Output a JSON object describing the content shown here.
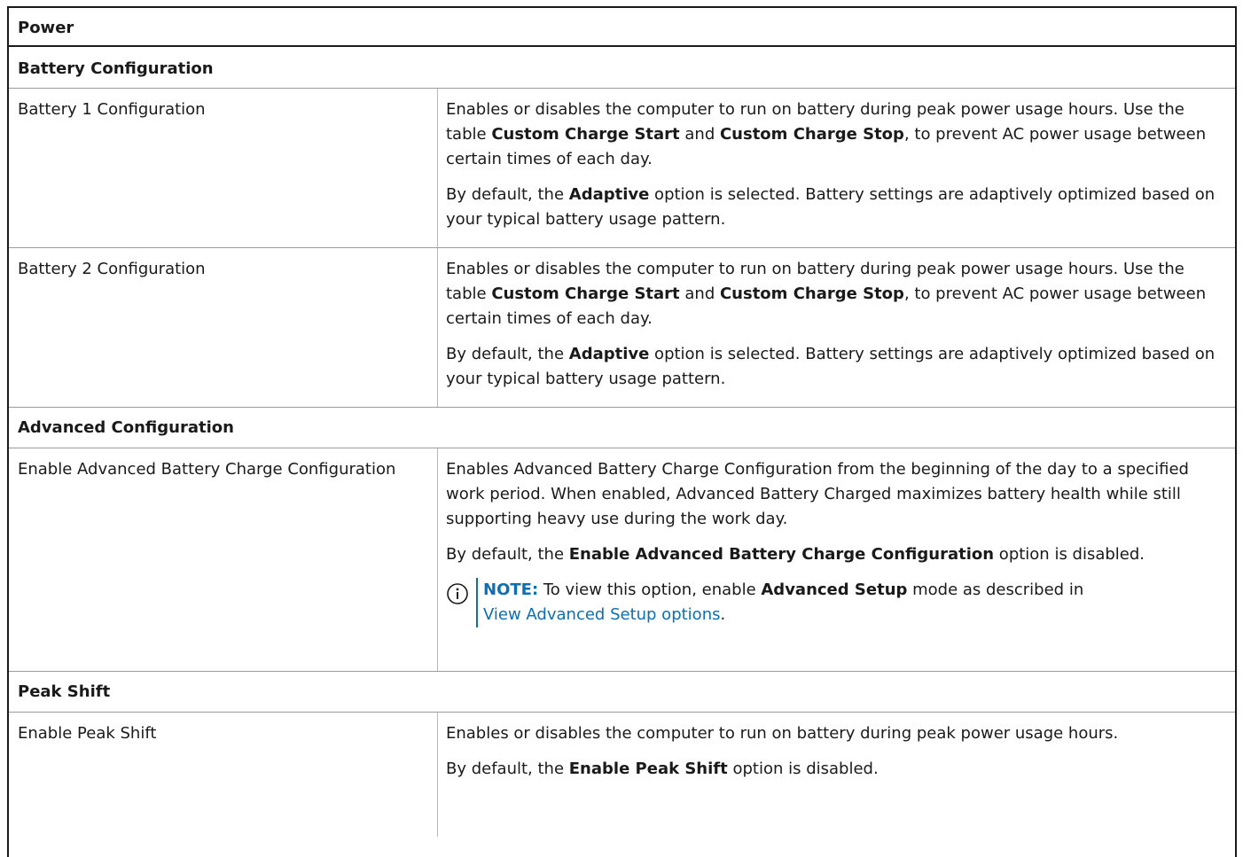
{
  "title": "Power",
  "sections": {
    "battery": {
      "heading": "Battery Configuration",
      "rows": [
        {
          "name": "Battery 1 Configuration",
          "desc1_a": "Enables or disables the computer to run on battery during peak power usage hours. Use the table ",
          "desc1_b1": "Custom Charge Start",
          "desc1_c": " and ",
          "desc1_b2": "Custom Charge Stop",
          "desc1_d": ", to prevent AC power usage between certain times of each day.",
          "desc2_a": "By default, the ",
          "desc2_b": "Adaptive",
          "desc2_c": " option is selected. Battery settings are adaptively optimized based on your typical battery usage pattern."
        },
        {
          "name": "Battery 2 Configuration",
          "desc1_a": "Enables or disables the computer to run on battery during peak power usage hours. Use the table ",
          "desc1_b1": "Custom Charge Start",
          "desc1_c": " and ",
          "desc1_b2": "Custom Charge Stop",
          "desc1_d": ", to prevent AC power usage between certain times of each day.",
          "desc2_a": "By default, the ",
          "desc2_b": "Adaptive",
          "desc2_c": " option is selected. Battery settings are adaptively optimized based on your typical battery usage pattern."
        }
      ]
    },
    "advanced": {
      "heading": "Advanced Configuration",
      "row": {
        "name": "Enable Advanced Battery Charge Configuration",
        "desc1": "Enables Advanced Battery Charge Configuration from the beginning of the day to a specified work period. When enabled, Advanced Battery Charged maximizes battery health while still supporting heavy use during the work day.",
        "desc2_a": "By default, the ",
        "desc2_b": "Enable Advanced Battery Charge Configuration",
        "desc2_c": " option is disabled.",
        "note_label": "NOTE:",
        "note_a": " To view this option, enable ",
        "note_b": "Advanced Setup",
        "note_c": " mode as described in ",
        "note_link": "View Advanced Setup options",
        "note_d": "."
      }
    },
    "peak": {
      "heading": "Peak Shift",
      "row": {
        "name": "Enable Peak Shift",
        "desc1": "Enables or disables the computer to run on battery during peak power usage hours.",
        "desc2_a": "By default, the ",
        "desc2_b": "Enable Peak Shift",
        "desc2_c": " option is disabled."
      }
    }
  },
  "colors": {
    "accent": "#0b6fb5",
    "border": "#1a1a1a",
    "divider": "#9c9c9c"
  }
}
